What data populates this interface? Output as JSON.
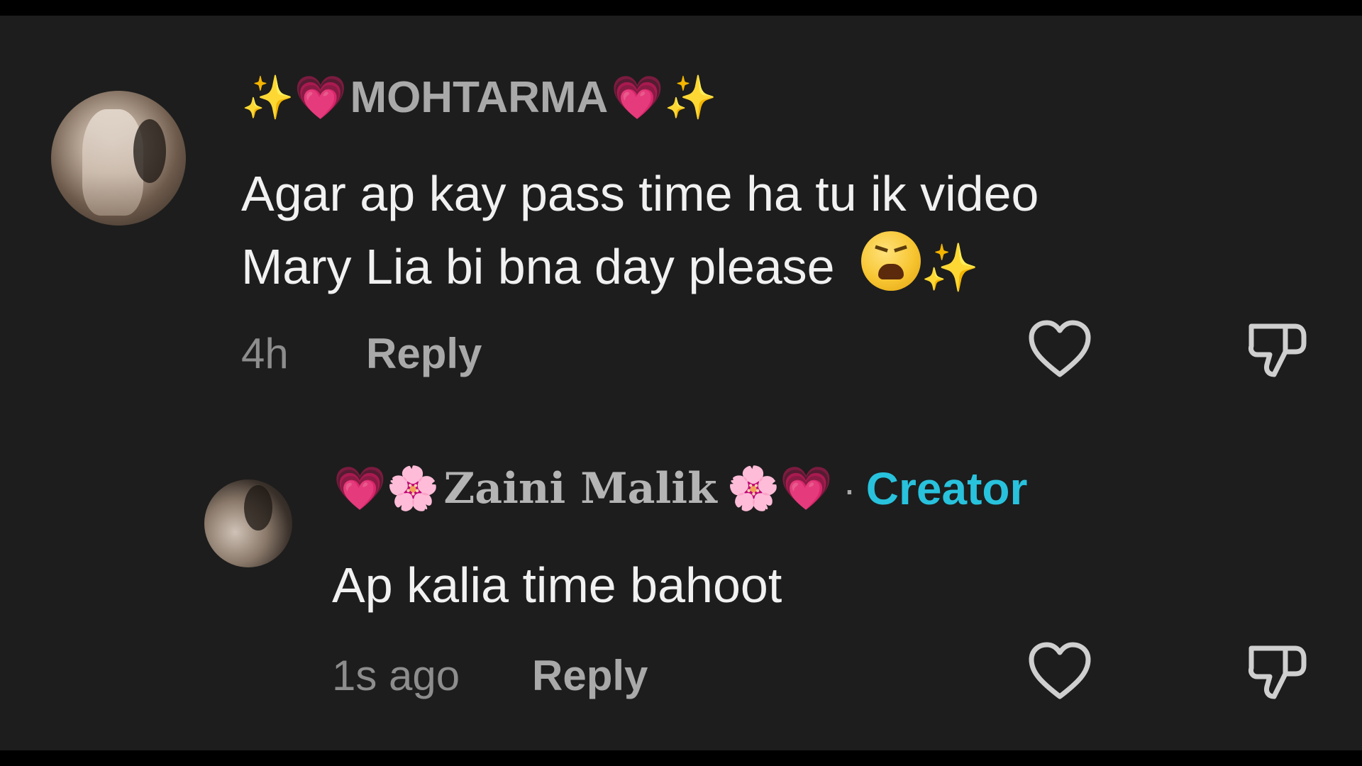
{
  "comments": [
    {
      "username": "MOHTARMA",
      "username_prefix": [
        "✨",
        "💗"
      ],
      "username_suffix": [
        "💗",
        "✨"
      ],
      "text_lines": [
        "Agar ap kay pass time ha tu ik video",
        "Mary Lia bi bna day please"
      ],
      "text_trailing_emoji": [
        "tired-face-emoji",
        "✨"
      ],
      "timestamp": "4h",
      "reply_label": "Reply",
      "icons": {
        "like": "heart-icon",
        "dislike": "thumbs-down-icon"
      }
    },
    {
      "username": "Zaini Malik",
      "username_prefix": [
        "💗",
        "🌸"
      ],
      "username_suffix": [
        "🌸",
        "💗"
      ],
      "separator": "·",
      "badge": "Creator",
      "text_lines": [
        "Ap kalia time bahoot"
      ],
      "timestamp": "1s ago",
      "reply_label": "Reply",
      "icons": {
        "like": "heart-icon",
        "dislike": "thumbs-down-icon"
      }
    }
  ],
  "colors": {
    "background": "#1d1d1d",
    "creator_badge": "#28c2dd",
    "username": "#a9a9a9",
    "body_text": "#f1f1f1",
    "meta_text": "#8d8d8d"
  }
}
